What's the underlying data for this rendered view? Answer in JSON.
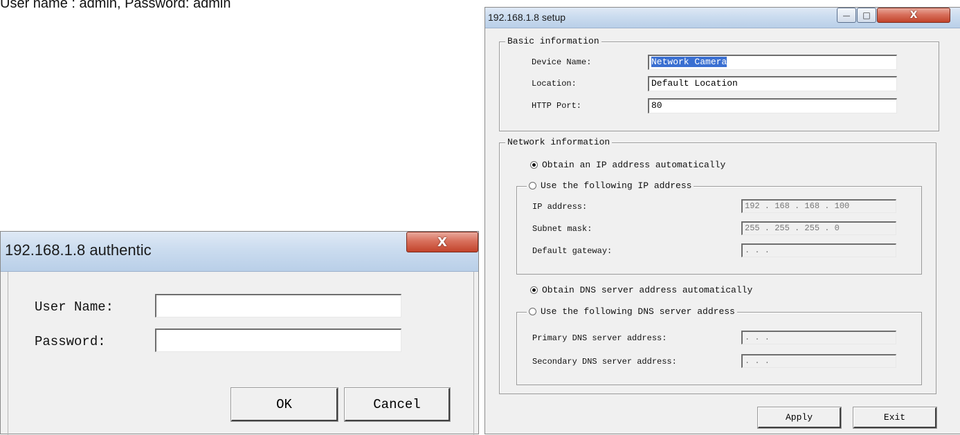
{
  "caption": "User name : admin, Password: admin",
  "auth_dialog": {
    "title": "192.168.1.8 authentic",
    "close_glyph": "X",
    "username_label": "User Name:",
    "username_value": "",
    "password_label": "Password:",
    "password_value": "",
    "ok_label": "OK",
    "cancel_label": "Cancel"
  },
  "setup_dialog": {
    "title": "192.168.1.8 setup",
    "minimize_glyph": "—",
    "maximize_glyph": "□",
    "close_glyph": "X",
    "basic": {
      "legend": "Basic information",
      "device_name_label": "Device Name:",
      "device_name_value": "Network Camera",
      "location_label": "Location:",
      "location_value": "Default Location",
      "http_port_label": "HTTP Port:",
      "http_port_value": "80"
    },
    "network": {
      "legend": "Network information",
      "obtain_ip_label": "Obtain an IP address automatically",
      "use_ip_label": "Use the following IP address",
      "ip_label": "IP address:",
      "ip_value": "192 . 168 . 168 . 100",
      "subnet_label": "Subnet mask:",
      "subnet_value": "255 . 255 . 255 .  0",
      "gateway_label": "Default gateway:",
      "gateway_value": " .   .   . ",
      "obtain_dns_label": "Obtain DNS server address automatically",
      "use_dns_label": "Use the following DNS server address",
      "primary_dns_label": "Primary DNS server address:",
      "primary_dns_value": " .   .   . ",
      "secondary_dns_label": "Secondary DNS server address:",
      "secondary_dns_value": " .   .   . "
    },
    "apply_label": "Apply",
    "exit_label": "Exit"
  }
}
